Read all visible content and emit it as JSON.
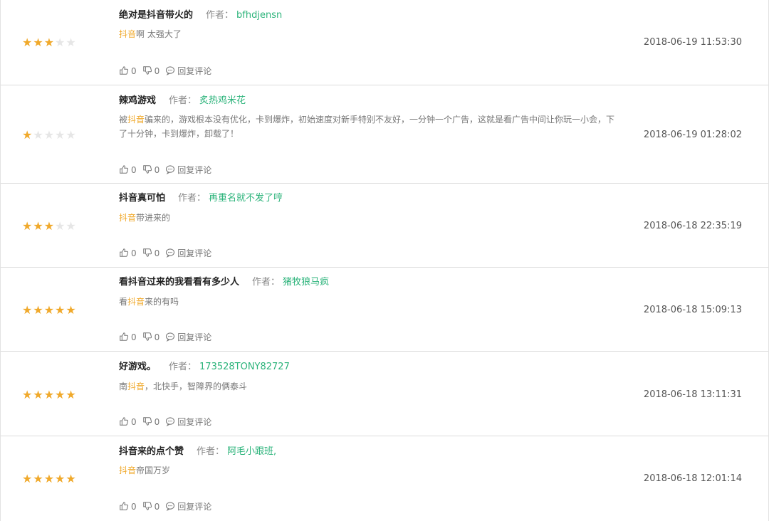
{
  "colors": {
    "star_on": "#f0a92b",
    "star_off": "#e6e6e6",
    "author": "#2bb37a",
    "keyword": "#f0a92b"
  },
  "labels": {
    "author_prefix": "作者：",
    "reply": "回复评论"
  },
  "reviews": [
    {
      "title": "绝对是抖音带火的",
      "author": "bfhdjensn",
      "rating": 3,
      "content_parts": [
        {
          "text": "抖音",
          "kw": true
        },
        {
          "text": "啊 太强大了",
          "kw": false
        }
      ],
      "time": "2018-06-19 11:53:30",
      "likes": "0",
      "dislikes": "0"
    },
    {
      "title": "辣鸡游戏",
      "author": "炙热鸡米花",
      "rating": 1,
      "content_parts": [
        {
          "text": "被",
          "kw": false
        },
        {
          "text": "抖音",
          "kw": true
        },
        {
          "text": "骗来的，游戏根本没有优化，卡到爆炸，初始速度对新手特别不友好，一分钟一个广告，这就是看广告中间让你玩一小会，下了十分钟，卡到爆炸，卸载了！",
          "kw": false
        }
      ],
      "time": "2018-06-19 01:28:02",
      "likes": "0",
      "dislikes": "0"
    },
    {
      "title": "抖音真可怕",
      "author": "再重名就不发了哼",
      "rating": 3,
      "content_parts": [
        {
          "text": "抖音",
          "kw": true
        },
        {
          "text": "带进来的",
          "kw": false
        }
      ],
      "time": "2018-06-18 22:35:19",
      "likes": "0",
      "dislikes": "0"
    },
    {
      "title": "看抖音过来的我看看有多少人",
      "author": "猪牧狼马疯",
      "rating": 5,
      "content_parts": [
        {
          "text": "看",
          "kw": false
        },
        {
          "text": "抖音",
          "kw": true
        },
        {
          "text": "来的有吗",
          "kw": false
        }
      ],
      "time": "2018-06-18 15:09:13",
      "likes": "0",
      "dislikes": "0"
    },
    {
      "title": "好游戏。",
      "author": "173528TONY82727",
      "rating": 5,
      "content_parts": [
        {
          "text": "南",
          "kw": false
        },
        {
          "text": "抖音",
          "kw": true
        },
        {
          "text": "，北快手，智障界的俩泰斗",
          "kw": false
        }
      ],
      "time": "2018-06-18 13:11:31",
      "likes": "0",
      "dislikes": "0"
    },
    {
      "title": "抖音来的点个赞",
      "author": "阿毛小跟班,",
      "rating": 5,
      "content_parts": [
        {
          "text": "抖音",
          "kw": true
        },
        {
          "text": "帝国万岁",
          "kw": false
        }
      ],
      "time": "2018-06-18 12:01:14",
      "likes": "0",
      "dislikes": "0"
    }
  ]
}
